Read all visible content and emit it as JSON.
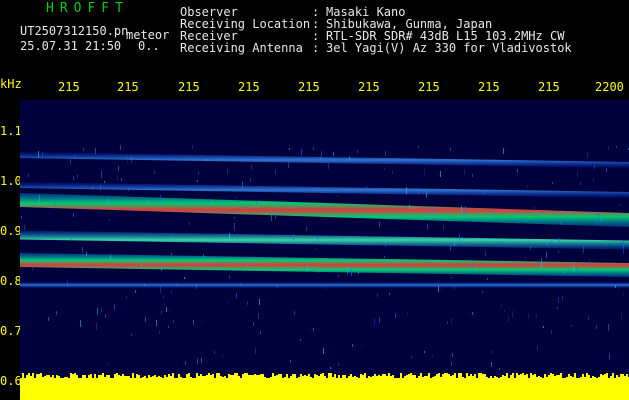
{
  "app": {
    "name": "HROFFT",
    "filename": "UT2507312150.pn",
    "mode": "meteor",
    "datetime": "25.07.31 21:50",
    "count": "0.."
  },
  "info": {
    "rows": [
      {
        "label": "Observer",
        "value": "Masaki Kano"
      },
      {
        "label": "Receiving Location",
        "value": "Shibukawa, Gunma, Japan"
      },
      {
        "label": "Receiver",
        "value": "RTL-SDR SDR# 43dB L15 103.2MHz CW"
      },
      {
        "label": "Receiving Antenna",
        "value": "3el Yagi(V) Az 330 for Vladivostok"
      }
    ]
  },
  "axis": {
    "y_unit": "kHz",
    "y_ticks": [
      "1.1",
      "1.0",
      "0.9",
      "0.8",
      "0.7",
      "0.6"
    ],
    "x_ticks": [
      "215",
      "215",
      "215",
      "215",
      "215",
      "215",
      "215",
      "215",
      "215",
      "2200"
    ]
  },
  "colors": {
    "background": "#000000",
    "plot_background": "#00003c",
    "axis_text": "#ffff00",
    "title_green": "#00d000",
    "noise_floor": "#ffff00"
  },
  "bands": [
    {
      "freq_start": 1.05,
      "freq_end": 1.03,
      "strength": "low"
    },
    {
      "freq_start": 0.99,
      "freq_end": 0.97,
      "strength": "low"
    },
    {
      "freq_start": 0.96,
      "freq_end": 0.92,
      "strength": "high"
    },
    {
      "freq_start": 0.89,
      "freq_end": 0.87,
      "strength": "medium"
    },
    {
      "freq_start": 0.84,
      "freq_end": 0.82,
      "strength": "high"
    },
    {
      "freq_start": 0.79,
      "freq_end": 0.79,
      "strength": "low"
    }
  ]
}
